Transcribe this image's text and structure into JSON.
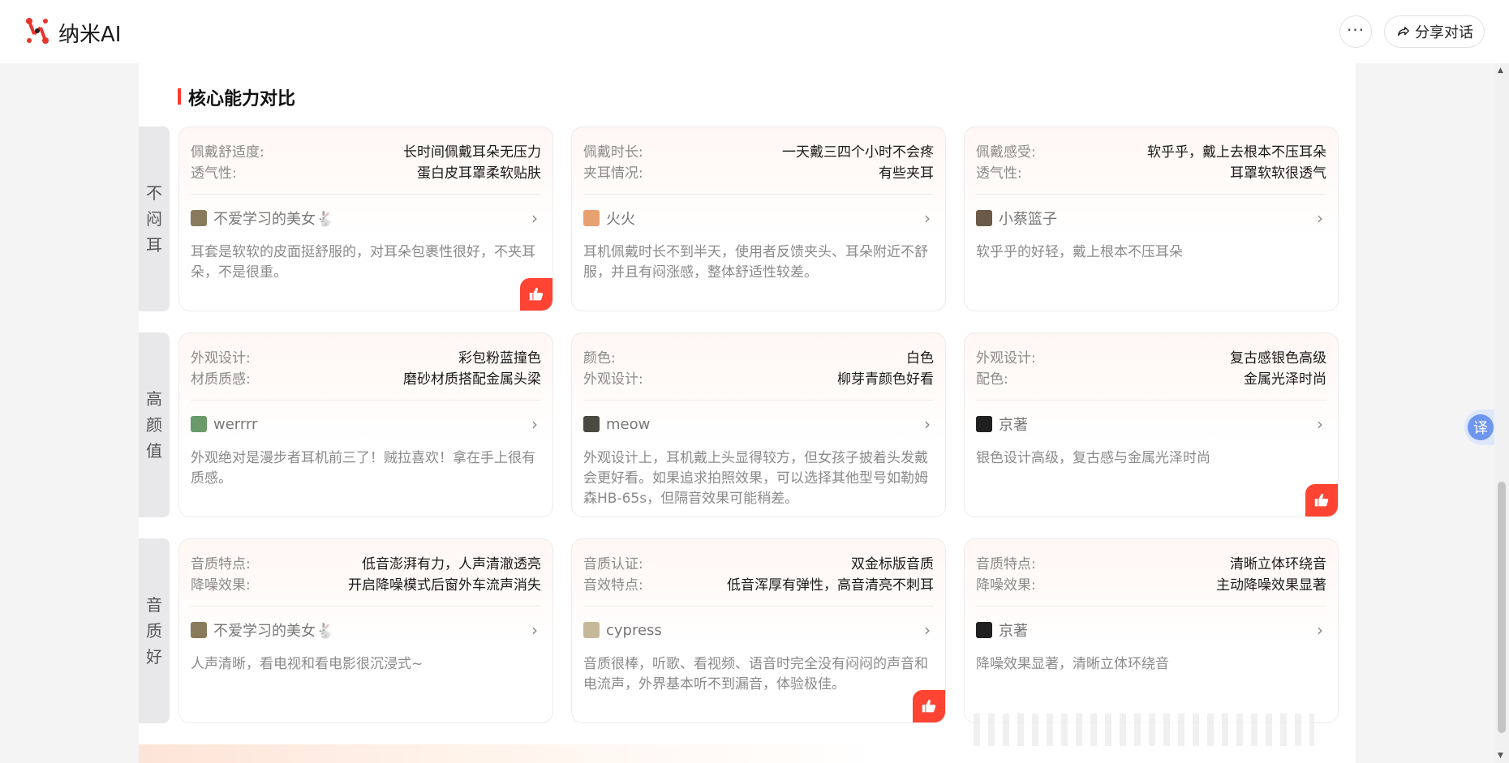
{
  "header": {
    "app_name": "纳米AI",
    "more_label": "···",
    "share_label": "分享对话"
  },
  "section": {
    "title": "核心能力对比"
  },
  "rows": [
    {
      "label_chars": [
        "不",
        "闷",
        "耳"
      ],
      "cards": [
        {
          "k1": "佩戴舒适度:",
          "v1": "长时间佩戴耳朵无压力",
          "k2": "透气性:",
          "v2": "蛋白皮耳罩柔软贴肤",
          "user": "不爱学习的美女🐇",
          "comment": "耳套是软软的皮面挺舒服的，对耳朵包裹性很好，不夹耳朵，不是很重。",
          "liked": true
        },
        {
          "k1": "佩戴时长:",
          "v1": "一天戴三四个小时不会疼",
          "k2": "夹耳情况:",
          "v2": "有些夹耳",
          "user": "火火",
          "comment": "耳机佩戴时长不到半天，使用者反馈夹头、耳朵附近不舒服，并且有闷涨感，整体舒适性较差。",
          "liked": false
        },
        {
          "k1": "佩戴感受:",
          "v1": "软乎乎，戴上去根本不压耳朵",
          "k2": "透气性:",
          "v2": "耳罩软软很透气",
          "user": "小蔡篮子",
          "comment": "软乎乎的好轻，戴上根本不压耳朵",
          "liked": false
        }
      ]
    },
    {
      "label_chars": [
        "高",
        "颜",
        "值"
      ],
      "cards": [
        {
          "k1": "外观设计:",
          "v1": "彩包粉蓝撞色",
          "k2": "材质质感:",
          "v2": "磨砂材质搭配金属头梁",
          "user": "werrrr",
          "comment": "外观绝对是漫步者耳机前三了！贼拉喜欢！拿在手上很有质感。",
          "liked": false
        },
        {
          "k1": "颜色:",
          "v1": "白色",
          "k2": "外观设计:",
          "v2": "柳芽青颜色好看",
          "user": "meow",
          "comment": "外观设计上，耳机戴上头显得较方，但女孩子披着头发戴会更好看。如果追求拍照效果，可以选择其他型号如勒姆森HB-65s，但隔音效果可能稍差。",
          "liked": false
        },
        {
          "k1": "外观设计:",
          "v1": "复古感银色高级",
          "k2": "配色:",
          "v2": "金属光泽时尚",
          "user": "京著",
          "comment": "银色设计高级，复古感与金属光泽时尚",
          "liked": true
        }
      ]
    },
    {
      "label_chars": [
        "音",
        "质",
        "好"
      ],
      "cards": [
        {
          "k1": "音质特点:",
          "v1": "低音澎湃有力，人声清澈透亮",
          "k2": "降噪效果:",
          "v2": "开启降噪模式后窗外车流声消失",
          "user": "不爱学习的美女🐇",
          "comment": "人声清晰，看电视和看电影很沉浸式~",
          "liked": false
        },
        {
          "k1": "音质认证:",
          "v1": "双金标版音质",
          "k2": "音效特点:",
          "v2": "低音浑厚有弹性，高音清亮不刺耳",
          "user": "cypress",
          "comment": "音质很棒，听歌、看视频、语音时完全没有闷闷的声音和电流声，外界基本听不到漏音，体验极佳。",
          "liked": true
        },
        {
          "k1": "音质特点:",
          "v1": "清晰立体环绕音",
          "k2": "降噪效果:",
          "v2": "主动降噪效果显著",
          "user": "京著",
          "comment": "降噪效果显著，清晰立体环绕音",
          "liked": false
        }
      ]
    }
  ],
  "translate_label": "译",
  "colors": {
    "accent": "#ff4433",
    "avatars": [
      "#8a7a5c",
      "#e8a070",
      "#6b5a48",
      "#6a9a6a",
      "#4a4a40",
      "#202020",
      "#8a7a5c",
      "#c8b89a",
      "#202020"
    ]
  }
}
